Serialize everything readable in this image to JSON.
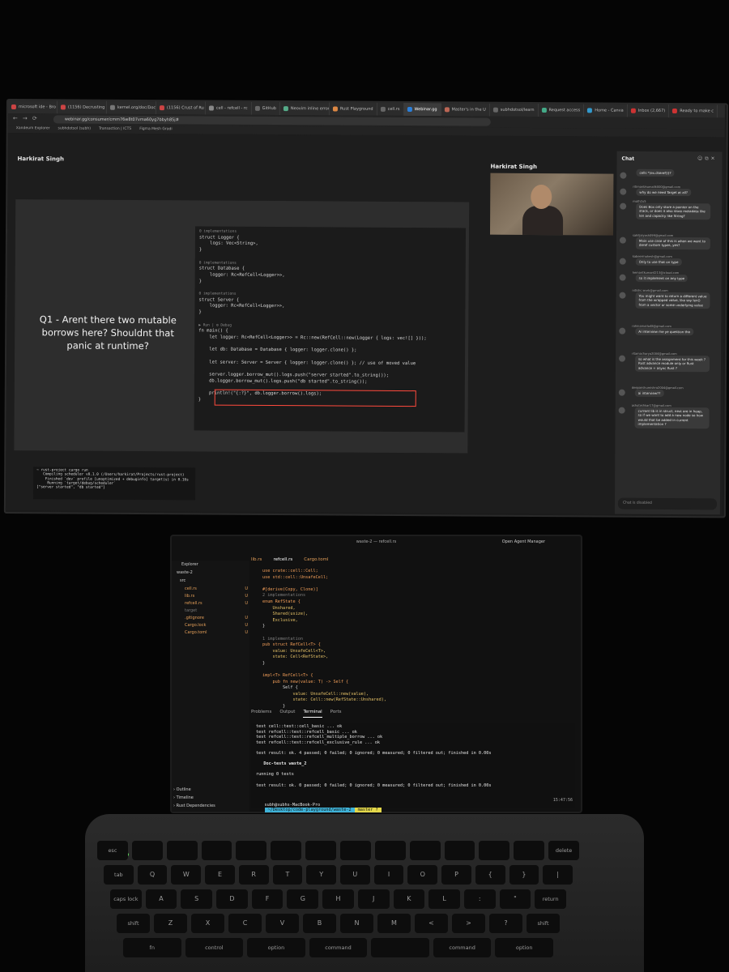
{
  "browser": {
    "tabs": [
      {
        "label": "microsoft ide - Bro",
        "active": false
      },
      {
        "label": "(1156) Decrusting",
        "active": false
      },
      {
        "label": "kernel.org/doc/Doc",
        "active": false
      },
      {
        "label": "(1156) Crust of Ru",
        "active": false
      },
      {
        "label": "cell - refcell - rc",
        "active": false
      },
      {
        "label": "GitHub",
        "active": false
      },
      {
        "label": "Neovim inline error",
        "active": false
      },
      {
        "label": "Rust Playground",
        "active": false
      },
      {
        "label": "cell.rs",
        "active": false
      },
      {
        "label": "Webinar.gg",
        "active": true
      },
      {
        "label": "Master's in the U",
        "active": false
      },
      {
        "label": "subhdotsol/learn",
        "active": false
      },
      {
        "label": "Request access",
        "active": false
      },
      {
        "label": "Home - Canva",
        "active": false
      },
      {
        "label": "Inbox (2,667)",
        "active": false
      },
      {
        "label": "Ready to make c",
        "active": false
      }
    ],
    "url": "webinar.gg/consumer/cmm76w8t07vma60yg7bbyh85j#",
    "bookmarks": [
      "Xandeum Explorer",
      "subhdotsol (subh)",
      "Transaction | ICTS",
      "Figma Mesh Gradi"
    ]
  },
  "webinar": {
    "presenter": "Harkirat Singh",
    "cam_label": "Harkirat Singh",
    "slide": {
      "question": "Q1 - Arent there two mutable borrows here? Shouldnt that panic at runtime?",
      "code_lines": [
        {
          "text": "0 implementations",
          "cls": "meta"
        },
        {
          "text": "struct Logger {",
          "cls": ""
        },
        {
          "text": "    logs: Vec<String>,",
          "cls": ""
        },
        {
          "text": "}",
          "cls": ""
        },
        {
          "text": "",
          "cls": ""
        },
        {
          "text": "0 implementations",
          "cls": "meta"
        },
        {
          "text": "struct Database {",
          "cls": ""
        },
        {
          "text": "    logger: Rc<RefCell<Logger>>,",
          "cls": ""
        },
        {
          "text": "}",
          "cls": ""
        },
        {
          "text": "",
          "cls": ""
        },
        {
          "text": "0 implementations",
          "cls": "meta"
        },
        {
          "text": "struct Server {",
          "cls": ""
        },
        {
          "text": "    logger: Rc<RefCell<Logger>>,",
          "cls": ""
        },
        {
          "text": "}",
          "cls": ""
        },
        {
          "text": "",
          "cls": ""
        },
        {
          "text": "▶ Run | ⚙ Debug",
          "cls": "meta"
        },
        {
          "text": "fn main() {",
          "cls": ""
        },
        {
          "text": "    let logger: Rc<RefCell<Logger>> = Rc::new(RefCell::new(Logger { logs: vec![] }));",
          "cls": ""
        },
        {
          "text": "",
          "cls": ""
        },
        {
          "text": "    let db: Database = Database { logger: logger.clone() };",
          "cls": ""
        },
        {
          "text": "",
          "cls": ""
        },
        {
          "text": "    let server: Server = Server { logger: logger.clone() }; // use of moved value",
          "cls": ""
        },
        {
          "text": "",
          "cls": ""
        },
        {
          "text": "    server.logger.borrow_mut().logs.push(\"server started\".to_string());",
          "cls": ""
        },
        {
          "text": "    db.logger.borrow_mut().logs.push(\"db started\".to_string());",
          "cls": ""
        },
        {
          "text": "",
          "cls": ""
        },
        {
          "text": "    println!(\"{:?}\", db.logger.borrow().logs);",
          "cls": ""
        },
        {
          "text": "}",
          "cls": ""
        }
      ],
      "terminal_lines": [
        "~ rust-project cargo run",
        "   Compiling scheduler v0.1.0 (/Users/harkirat/Projects/rust-project)",
        "    Finished `dev` profile [unoptimized + debuginfo] target(s) in 0.16s",
        "     Running `target/debug/scheduler`",
        "[\"server started\", \"db started\"]"
      ]
    },
    "chat": {
      "title": "Chat",
      "input_placeholder": "Chat is disabled",
      "messages": [
        {
          "who": "",
          "text": "cells *(ex.dseref())?"
        },
        {
          "who": "ritimanbhumalik000@gmail.com",
          "text": "why do we need Target at all?"
        },
        {
          "who": "math2u5",
          "text": "Does Box only store a pointer on the stack, or does it also store metadata like len and capacity like String?"
        },
        {
          "who": "sahiljaiyash099@gmail.com",
          "text": "Main use case of this is when we want to deref custom types, yes?"
        },
        {
          "who": "kabeermahesh@gmail.com",
          "text": "Only to use that on type"
        },
        {
          "who": "hemantkumar4213@icloud.com",
          "text": "so it implement on any type"
        },
        {
          "who": "nitishc.work@gmail.com",
          "text": "You might want to return a different value from the wrapped value, like say len() from a vector or some underlying value"
        },
        {
          "who": "rohinamotla48@gmail.com",
          "text": "Ai interview me ye question tha"
        },
        {
          "who": "ritamacharya2004@gmail.com",
          "text": "so what is the assignment for this week ? Rust advance module only or Rust advance + async Rust ?"
        },
        {
          "who": "deepanshumishra2004@gmail.com",
          "text": "ai interview??"
        },
        {
          "who": "ashutoshkar17@gmail.com",
          "text": "current lib is in struct, next are in heap, so if we want to add a new node so how would that be added in current implementation ?"
        }
      ]
    }
  },
  "laptop": {
    "window_title": "waste-2 — refcell.rs",
    "agent_manager": "Open Agent Manager",
    "sidebar": {
      "header": "Explorer",
      "project": "waste-2",
      "folder": "src",
      "files": [
        {
          "name": "cell.rs",
          "status": "U"
        },
        {
          "name": "lib.rs",
          "status": "U"
        },
        {
          "name": "refcell.rs",
          "status": "U"
        },
        {
          "name": "target",
          "status": ""
        },
        {
          "name": ".gitignore",
          "status": "U"
        },
        {
          "name": "Cargo.lock",
          "status": "U"
        },
        {
          "name": "Cargo.toml",
          "status": "U"
        }
      ],
      "footer": [
        "Outline",
        "Timeline",
        "Rust Dependencies"
      ]
    },
    "editor_tabs": [
      "lib.rs",
      "refcell.rs",
      "Cargo.toml"
    ],
    "breadcrumb": "src › refcell.rs",
    "code": [
      "use crate::cell::Cell;",
      "use std::cell::UnsafeCell;",
      "",
      "#[derive(Copy, Clone)]",
      "2 implementations",
      "enum RefState {",
      "    Unshared,",
      "    Shared(usize),",
      "    Exclusive,",
      "}",
      "",
      "1 implementation",
      "pub struct RefCell<T> {",
      "    value: UnsafeCell<T>,",
      "    state: Cell<RefState>,",
      "}",
      "",
      "impl<T> RefCell<T> {",
      "    pub fn new(value: T) -> Self {",
      "        Self {",
      "            value: UnsafeCell::new(value),",
      "            state: Cell::new(RefState::Unshared),",
      "        }"
    ],
    "panel_tabs": [
      "Problems",
      "Output",
      "Terminal",
      "Ports"
    ],
    "terminal_lines": [
      "test cell::test::cell_basic ... ok",
      "test refcell::test::refcell_basic ... ok",
      "test refcell::test::refcell_multiple_borrow ... ok",
      "test refcell::test::refcell_exclusive_rule ... ok",
      "",
      "test result: ok. 4 passed; 0 failed; 0 ignored; 0 measured; 0 filtered out; finished in 0.00s",
      "",
      "   Doc-tests waste_2",
      "",
      "running 0 tests",
      "",
      "test result: ok. 0 passed; 0 failed; 0 ignored; 0 measured; 0 filtered out; finished in 0.00s"
    ],
    "prompt": {
      "user": "subh@subhs-MacBook-Pro",
      "path": "~/Desktop/code-playground/waste-2",
      "branch": "master ?"
    },
    "clock": "15:47:56"
  },
  "keyboard": {
    "row1": [
      "esc",
      "",
      "",
      "",
      "",
      "",
      "",
      "",
      "",
      "",
      "",
      "",
      "",
      "delete"
    ],
    "row2": [
      "tab",
      "Q",
      "W",
      "E",
      "R",
      "T",
      "Y",
      "U",
      "I",
      "O",
      "P",
      "{",
      "}",
      "|"
    ],
    "row3": [
      "caps lock",
      "A",
      "S",
      "D",
      "F",
      "G",
      "H",
      "J",
      "K",
      "L",
      ":",
      "\"",
      "return"
    ],
    "row4": [
      "shift",
      "Z",
      "X",
      "C",
      "V",
      "B",
      "N",
      "M",
      "<",
      ">",
      "?",
      "shift"
    ],
    "row5": [
      "fn",
      "control",
      "option",
      "command",
      "",
      "command",
      "option"
    ]
  }
}
